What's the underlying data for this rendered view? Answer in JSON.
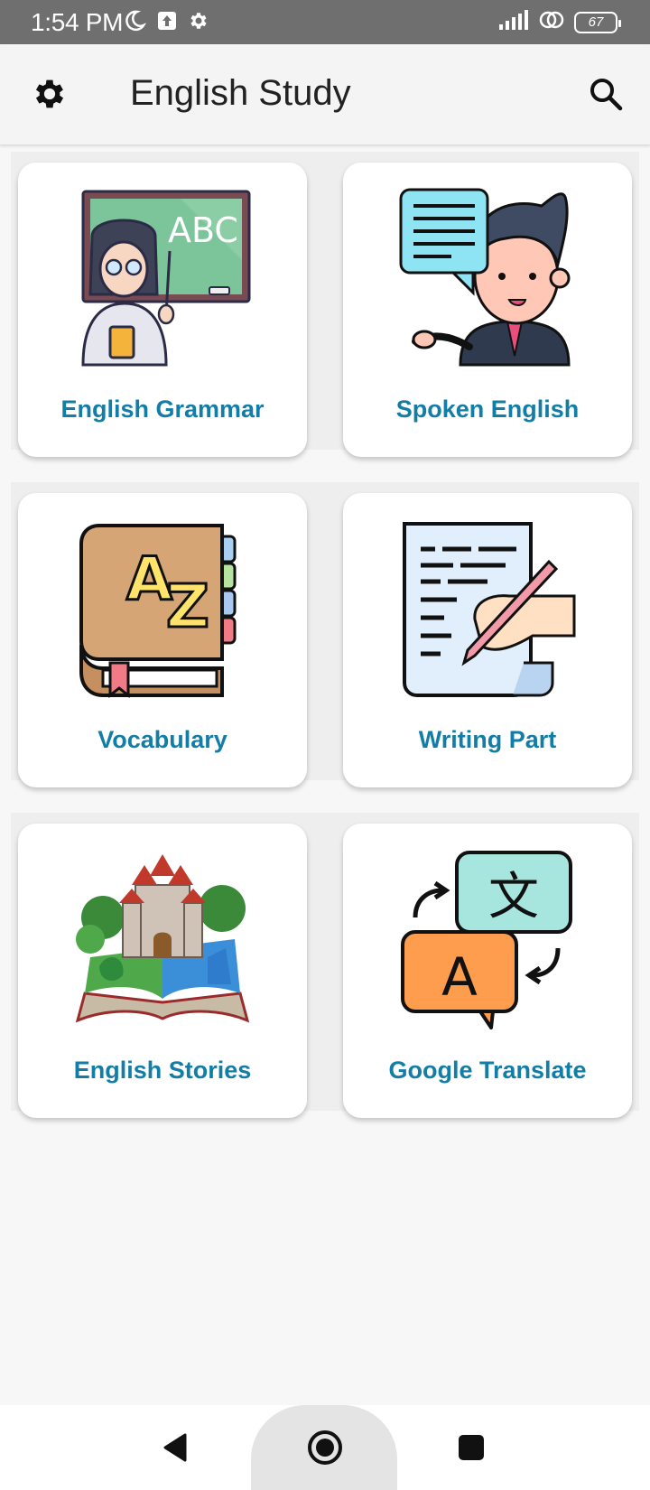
{
  "status_bar": {
    "time": "1:54 PM",
    "battery": "67",
    "icons": [
      "moon-icon",
      "upload-icon",
      "gear-icon",
      "signal-icon",
      "hotspot-icon",
      "battery-icon"
    ]
  },
  "app_bar": {
    "title": "English Study",
    "settings_icon": "gear-icon",
    "search_icon": "search-icon"
  },
  "cards": [
    {
      "label": "English Grammar",
      "icon": "teacher-blackboard-icon"
    },
    {
      "label": "Spoken English",
      "icon": "speaking-man-icon"
    },
    {
      "label": "Vocabulary",
      "icon": "az-book-icon"
    },
    {
      "label": "Writing Part",
      "icon": "writing-paper-icon"
    },
    {
      "label": "English Stories",
      "icon": "story-book-castle-icon"
    },
    {
      "label": "Google Translate",
      "icon": "translate-bubbles-icon"
    }
  ],
  "illustration_text": {
    "blackboard": "ABC",
    "book_a": "A",
    "book_z": "Z",
    "translate_cjk": "文",
    "translate_a": "A"
  },
  "nav_bar": {
    "back": "back-icon",
    "home": "home-icon",
    "recents": "recents-icon"
  },
  "colors": {
    "label": "#127ea8",
    "status_bar": "#6f6f6f",
    "app_bar": "#f4f4f4"
  }
}
